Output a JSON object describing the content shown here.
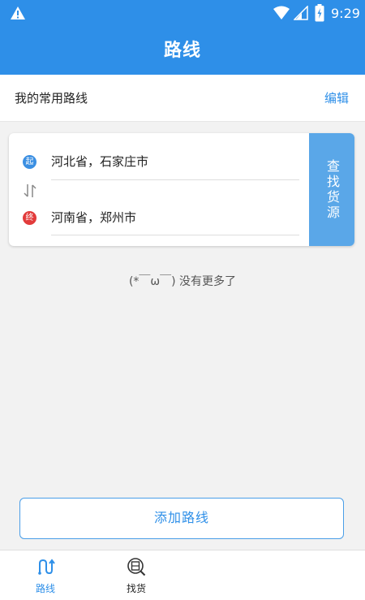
{
  "status_bar": {
    "time": "9:29",
    "icons": [
      "warning-icon",
      "wifi-icon",
      "signal-icon",
      "battery-icon"
    ]
  },
  "app_bar": {
    "title": "路线"
  },
  "routes_header": {
    "label": "我的常用路线",
    "edit_label": "编辑"
  },
  "route": {
    "from_badge": "起",
    "from": "河北省，石家庄市",
    "to_badge": "终",
    "to": "河南省，郑州市",
    "find_label": "查找货源"
  },
  "empty_message": "(*￣ω￣) 没有更多了",
  "add_route_label": "添加路线",
  "tabs": [
    {
      "label": "路线",
      "icon": "route-icon",
      "active": true
    },
    {
      "label": "找货",
      "icon": "find-goods-icon",
      "active": false
    }
  ],
  "colors": {
    "primary": "#2e8fe8",
    "find_button": "#5aa7e8",
    "start_badge": "#3b8fe2",
    "end_badge": "#e23b3b"
  }
}
